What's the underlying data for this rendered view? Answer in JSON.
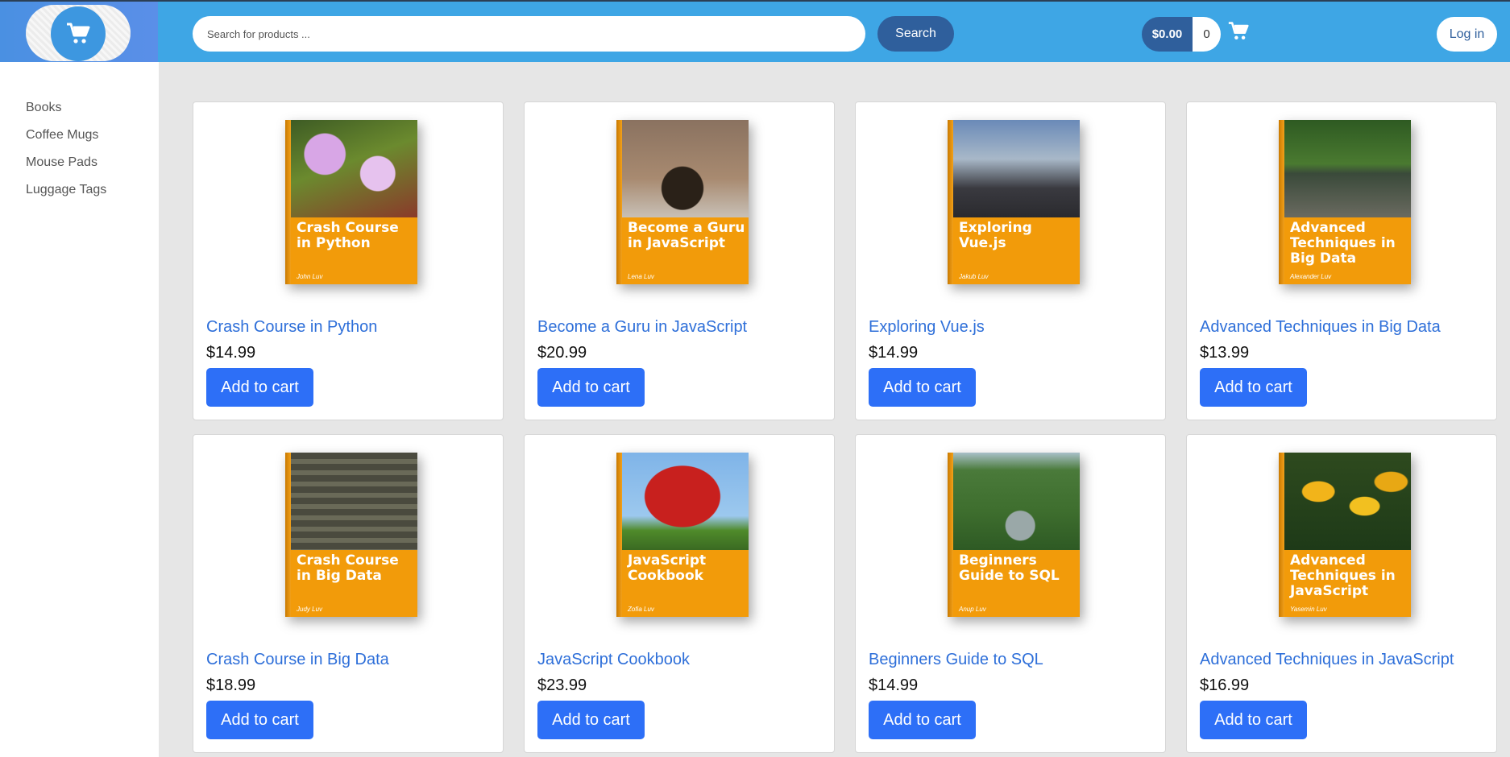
{
  "header": {
    "search_placeholder": "Search for products ...",
    "search_label": "Search",
    "cart_total": "$0.00",
    "cart_count": "0",
    "login_label": "Log in",
    "cart_icon": "shopping-cart-icon",
    "logo_icon": "shopping-cart-icon"
  },
  "sidebar": {
    "items": [
      {
        "label": "Books"
      },
      {
        "label": "Coffee Mugs"
      },
      {
        "label": "Mouse Pads"
      },
      {
        "label": "Luggage Tags"
      }
    ]
  },
  "products": [
    {
      "name": "Crash Course in Python",
      "price": "$14.99",
      "cover_title": "Crash Course in Python",
      "author": "John Luv",
      "button": "Add to cart"
    },
    {
      "name": "Become a Guru in JavaScript",
      "price": "$20.99",
      "cover_title": "Become a Guru in JavaScript",
      "author": "Lena Luv",
      "button": "Add to cart"
    },
    {
      "name": "Exploring Vue.js",
      "price": "$14.99",
      "cover_title": "Exploring Vue.js",
      "author": "Jakub Luv",
      "button": "Add to cart"
    },
    {
      "name": "Advanced Techniques in Big Data",
      "price": "$13.99",
      "cover_title": "Advanced Techniques in Big Data",
      "author": "Alexander Luv",
      "button": "Add to cart"
    },
    {
      "name": "Crash Course in Big Data",
      "price": "$18.99",
      "cover_title": "Crash Course in Big Data",
      "author": "Judy Luv",
      "button": "Add to cart"
    },
    {
      "name": "JavaScript Cookbook",
      "price": "$23.99",
      "cover_title": "JavaScript Cookbook",
      "author": "Zofia Luv",
      "button": "Add to cart"
    },
    {
      "name": "Beginners Guide to SQL",
      "price": "$14.99",
      "cover_title": "Beginners Guide to SQL",
      "author": "Anup Luv",
      "button": "Add to cart"
    },
    {
      "name": "Advanced Techniques in JavaScript",
      "price": "$16.99",
      "cover_title": "Advanced Techniques in JavaScript",
      "author": "Yasemin Luv",
      "button": "Add to cart"
    }
  ],
  "colors": {
    "header_bg": "#3ea6e5",
    "accent_dark": "#2f5f9c",
    "link": "#2e6fd9",
    "button": "#2d6ff7",
    "cover_orange": "#f29b0a"
  }
}
